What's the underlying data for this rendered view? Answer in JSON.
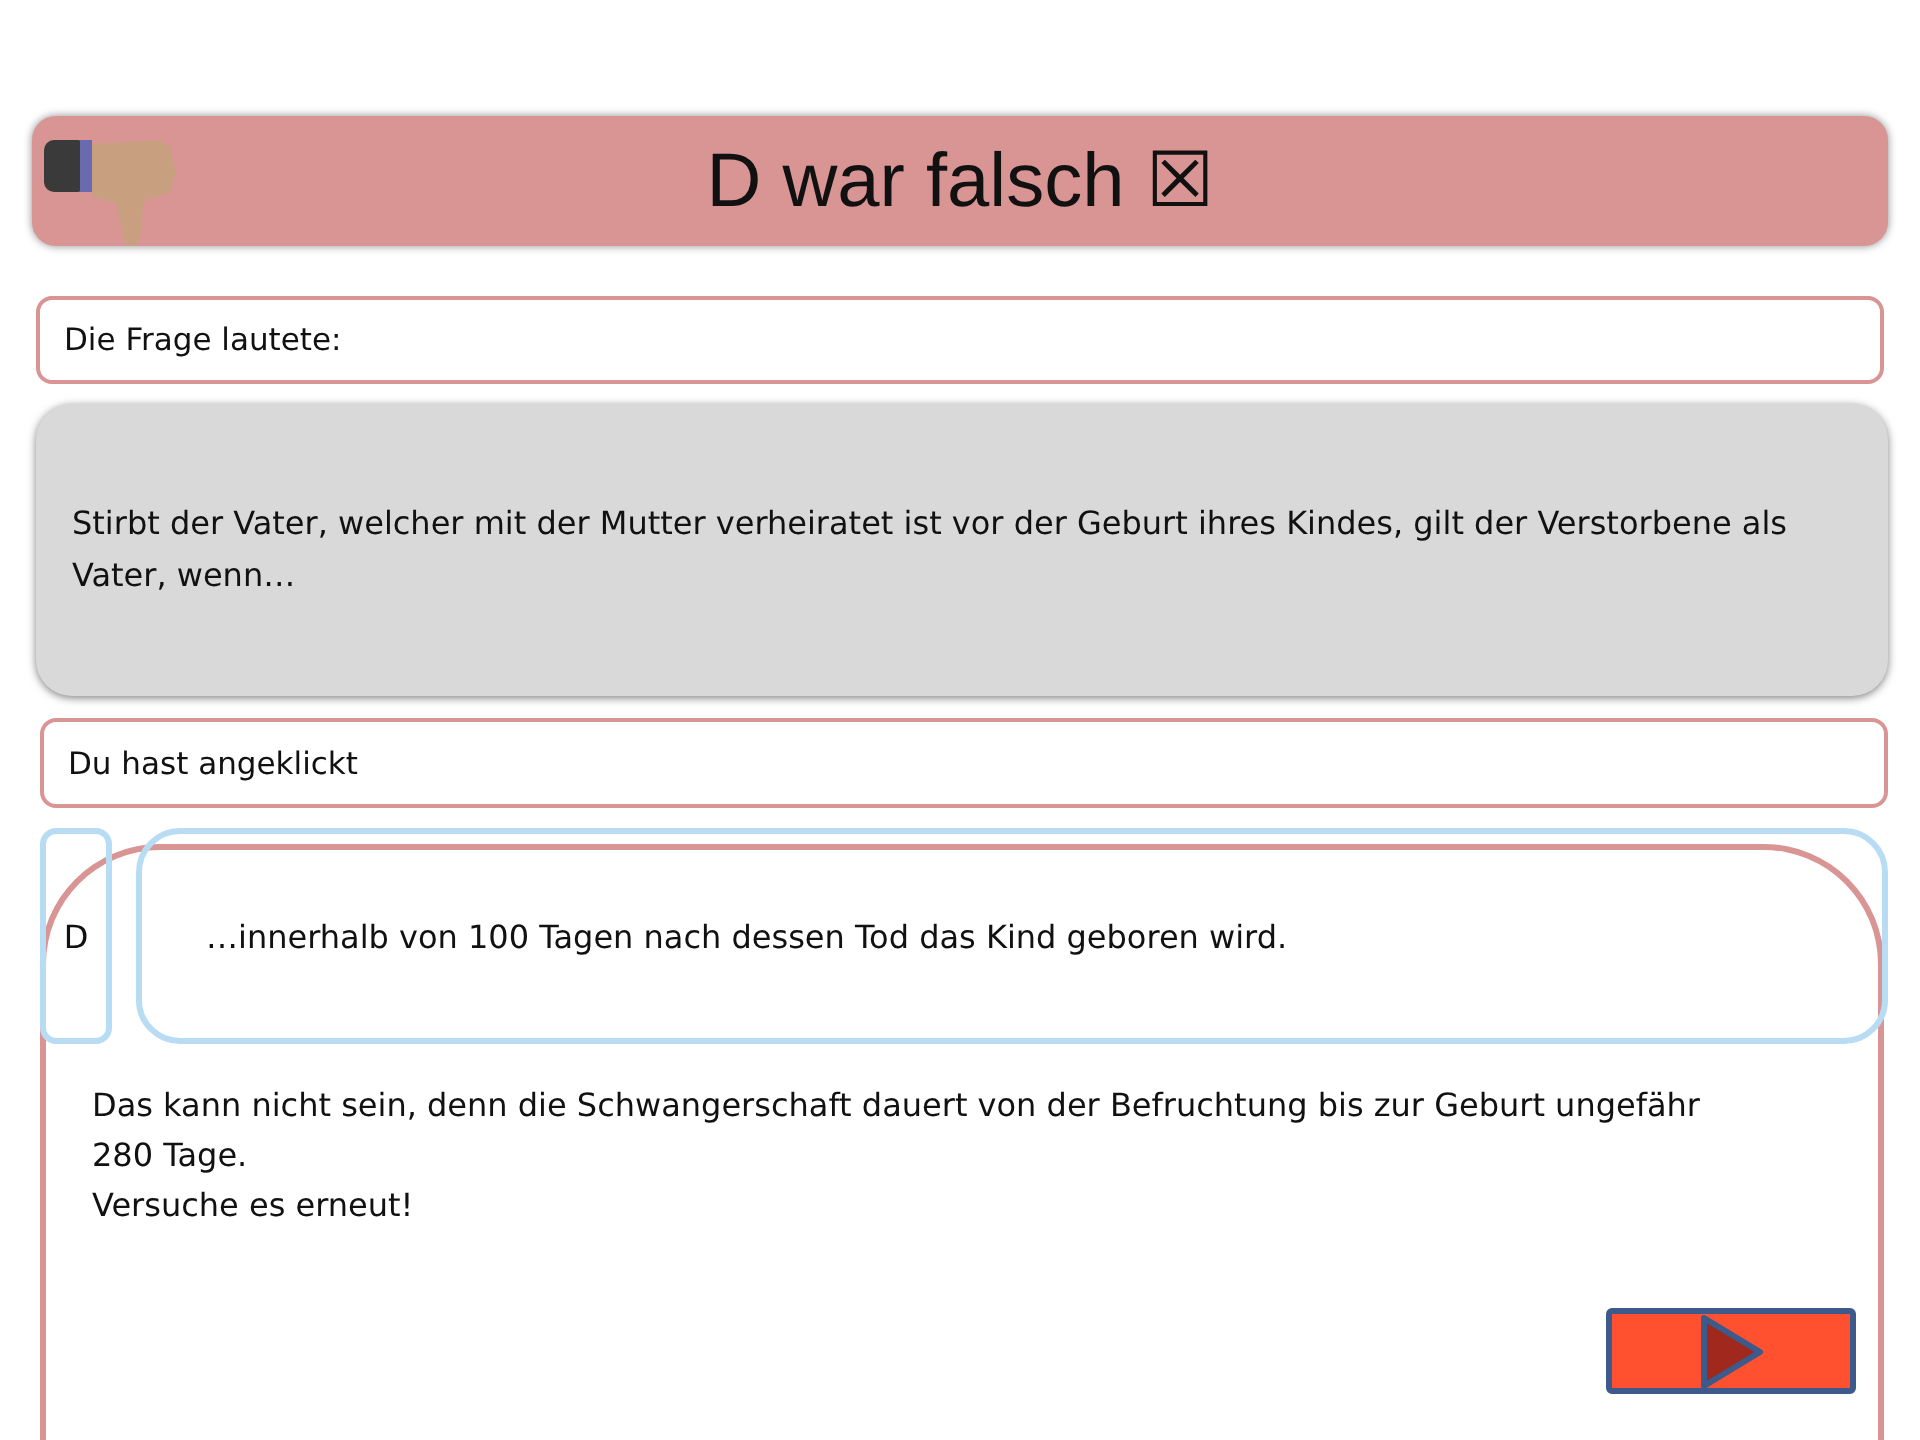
{
  "header": {
    "title": "D war falsch ☒"
  },
  "question_label": "Die Frage lautete:",
  "question": "Stirbt der Vater, welcher mit der Mutter verheiratet ist vor der Geburt ihres Kindes, gilt der Verstorbene als Vater, wenn…",
  "clicked_label": "Du hast angeklickt",
  "answer": {
    "letter": "D",
    "text": "…innerhalb von 100 Tagen nach dessen Tod das Kind geboren wird."
  },
  "feedback": [
    "Das kann nicht sein, denn die Schwangerschaft dauert von der Befruchtung bis zur Geburt ungefähr 280 Tage.",
    "Versuche es erneut!"
  ]
}
